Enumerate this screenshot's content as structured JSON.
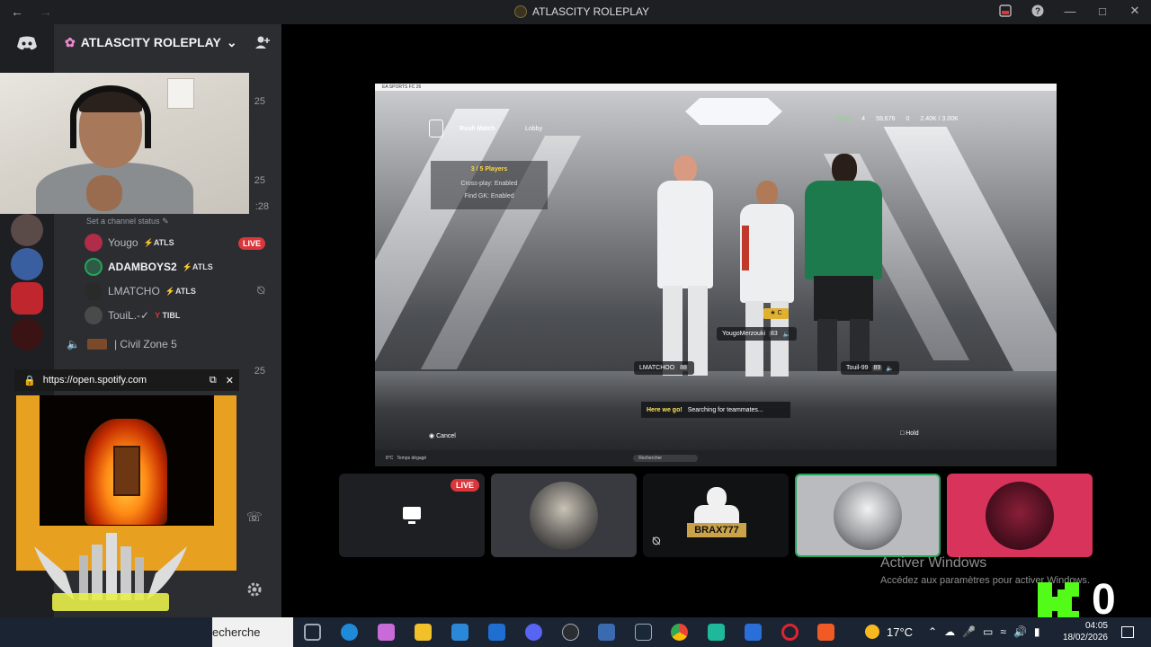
{
  "window": {
    "title": "ATLASCITY ROLEPLAY",
    "back_icon": "arrow-left-icon",
    "forward_icon": "arrow-right-icon"
  },
  "server": {
    "name": "ATLASCITY ROLEPLAY",
    "counts": [
      "25",
      "25",
      ":28",
      "25"
    ]
  },
  "channel_status": "Set a channel status",
  "members": [
    {
      "name": "Yougo",
      "tag": "ATLS",
      "live": "LIVE"
    },
    {
      "name": "ADAMBOYS2",
      "tag": "ATLS"
    },
    {
      "name": "LMATCHO",
      "tag": "ATLS"
    },
    {
      "name": "TouiL.-✓",
      "tag": "TIBL"
    }
  ],
  "voice_channel": "| Civil Zone 5",
  "spotify": {
    "url": "https://open.spotify.com"
  },
  "game": {
    "window_title": "EA SPORTS FC 26",
    "nav": [
      "Rush Match",
      "Lobby"
    ],
    "stats": [
      "MAX",
      "4",
      "59,676",
      "0",
      "2.40K / 3.00K"
    ],
    "lobby": {
      "players": "3 / 5 Players",
      "crossplay": "Cross-play: Enabled",
      "find_gk": "Find GK: Enabled"
    },
    "names": [
      {
        "name": "YougoMerzouki",
        "rating": "83"
      },
      {
        "name": "LMATCHOO",
        "rating": "88"
      },
      {
        "name": "Touil-99",
        "rating": "89"
      }
    ],
    "toast_title": "Here we go!",
    "toast_text": "Searching for teammates...",
    "cancel": "Cancel",
    "hold": "Hold",
    "captain": "C",
    "taskbar_search": "Rechercher",
    "taskbar_weather": "8°C",
    "taskbar_weather2": "Temps dégagé"
  },
  "tiles": [
    {
      "id": "screen",
      "live": "LIVE",
      "color": "#1e1f22"
    },
    {
      "id": "moto",
      "color": "#383a40"
    },
    {
      "id": "brax",
      "label": "BRAX777",
      "color": "#111214"
    },
    {
      "id": "soldier",
      "color": "#b9bbbe"
    },
    {
      "id": "anime",
      "color": "#d8335a"
    }
  ],
  "activate": {
    "title": "Activer Windows",
    "subtitle": "Accédez aux paramètres pour activer Windows."
  },
  "overlay_count": "0",
  "taskbar": {
    "search_text": "echerche",
    "temperature": "17°C",
    "time": "04:05",
    "date": "18/02/2026"
  }
}
